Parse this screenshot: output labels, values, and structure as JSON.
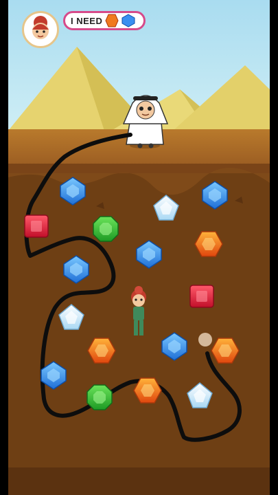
{
  "hud": {
    "need_label": "I NEED",
    "needed_items": [
      "orange-gem-icon",
      "blue-gem-icon"
    ]
  },
  "colors": {
    "sky": "#a9dcf0",
    "pyramid": "#e8d877",
    "sand": "#b97a2c",
    "dirt": "#6e3f14",
    "path": "#0d0d0d",
    "need_border": "#d64a8a"
  },
  "gems": [
    {
      "kind": "blue-gem"
    },
    {
      "kind": "blue-gem"
    },
    {
      "kind": "red-gem"
    },
    {
      "kind": "green-gem"
    },
    {
      "kind": "white-gem"
    },
    {
      "kind": "orange-gem"
    },
    {
      "kind": "blue-gem"
    },
    {
      "kind": "blue-gem"
    },
    {
      "kind": "red-gem"
    },
    {
      "kind": "white-gem"
    },
    {
      "kind": "orange-gem"
    },
    {
      "kind": "blue-gem"
    },
    {
      "kind": "orange-gem"
    },
    {
      "kind": "blue-gem"
    },
    {
      "kind": "green-gem"
    },
    {
      "kind": "orange-gem"
    },
    {
      "kind": "white-gem"
    }
  ]
}
